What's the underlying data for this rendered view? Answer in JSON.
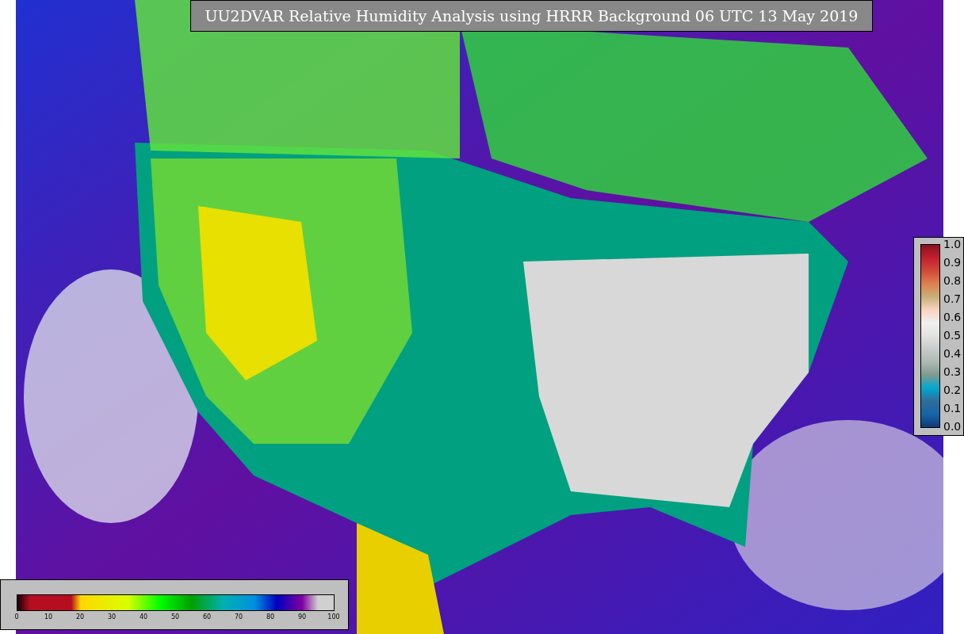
{
  "title": "UU2DVAR Relative Humidity Analysis using HRRR Background 06 UTC 13 May 2019",
  "humidity_legend": {
    "ticks": [
      "0",
      "10",
      "20",
      "30",
      "40",
      "50",
      "60",
      "70",
      "80",
      "90",
      "100"
    ]
  },
  "ratio_legend": {
    "ticks": [
      "1.0",
      "0.9",
      "0.8",
      "0.7",
      "0.6",
      "0.5",
      "0.4",
      "0.3",
      "0.2",
      "0.1",
      "0.0"
    ]
  }
}
